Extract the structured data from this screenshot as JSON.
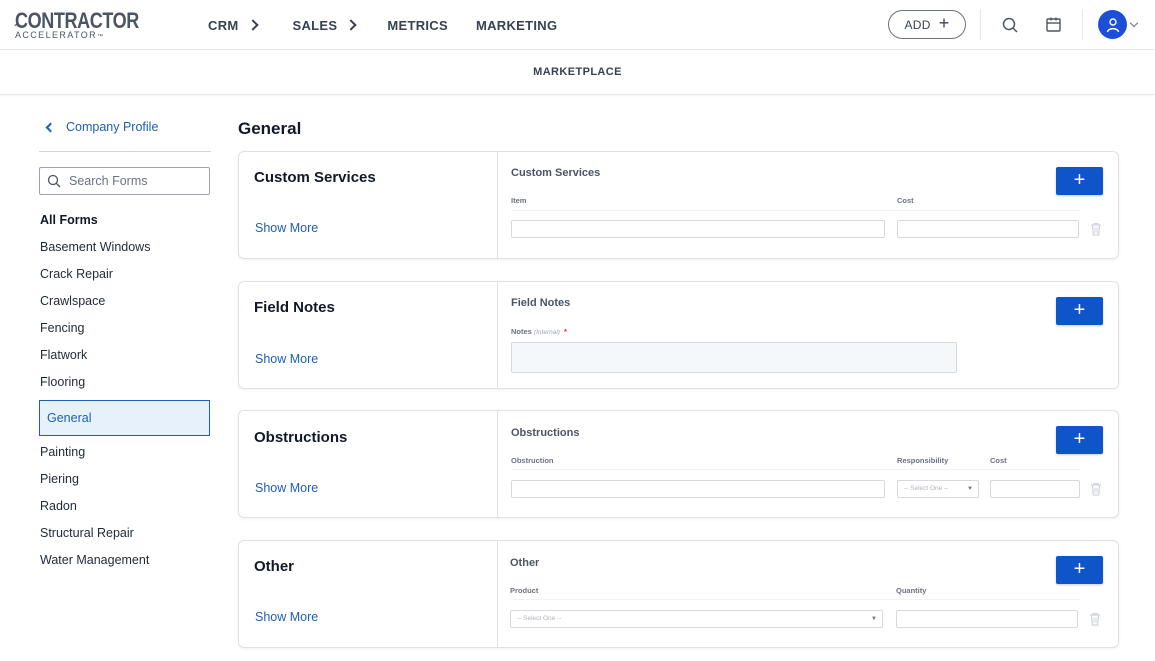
{
  "brand": {
    "name_big": "CONTRACTOR",
    "name_small": "ACCELERATOR",
    "trademark": "™"
  },
  "topnav": {
    "items": [
      {
        "label": "CRM",
        "has_chevron": true
      },
      {
        "label": "SALES",
        "has_chevron": true
      },
      {
        "label": "METRICS",
        "has_chevron": false
      },
      {
        "label": "MARKETING",
        "has_chevron": false
      }
    ],
    "add_label": "ADD",
    "add_icon": "plus-icon",
    "search_icon": "search-icon",
    "calendar_icon": "calendar-icon",
    "user_icon": "user-icon",
    "accent": "#1d4ed8"
  },
  "subnav": {
    "link": "MARKETPLACE"
  },
  "sidebar": {
    "back_label": "Company Profile",
    "search_placeholder": "Search Forms",
    "heading": "All Forms",
    "items": [
      "Basement Windows",
      "Crack Repair",
      "Crawlspace",
      "Fencing",
      "Flatwork",
      "Flooring",
      "General",
      "Painting",
      "Piering",
      "Radon",
      "Structural Repair",
      "Water Management"
    ],
    "active_item": "General"
  },
  "main": {
    "section_title": "General",
    "show_more_label": "Show More",
    "cards": [
      {
        "title": "Custom Services",
        "preview_title": "Custom Services",
        "labels": [
          "Item",
          "Cost"
        ]
      },
      {
        "title": "Field Notes",
        "preview_title": "Field Notes",
        "labels": [
          "Notes"
        ],
        "note_qualifier": "(Internal)",
        "required_mark": "*"
      },
      {
        "title": "Obstructions",
        "preview_title": "Obstructions",
        "labels": [
          "Obstruction",
          "Responsibility",
          "Cost"
        ],
        "select_placeholder": "-- Select One --"
      },
      {
        "title": "Other",
        "preview_title": "Other",
        "labels": [
          "Product",
          "Quantity"
        ],
        "select_placeholder": "-- Select One --"
      }
    ]
  },
  "colors": {
    "link_blue": "#1d5fb8",
    "primary_button": "#0d55c9",
    "active_bg": "#e7f1fb"
  }
}
